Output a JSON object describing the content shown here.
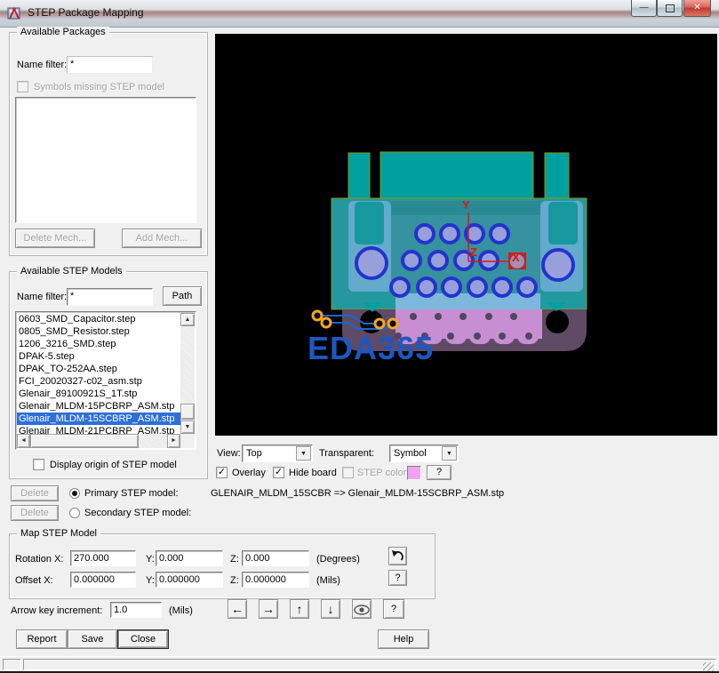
{
  "window": {
    "title": "STEP Package Mapping"
  },
  "icons": {
    "minimize": "—",
    "close": "✕",
    "check": "✓",
    "scroll_up": "▲",
    "scroll_down": "▼",
    "scroll_left": "◄",
    "scroll_right": "►",
    "dropdown": "▼",
    "nudge_left": "←",
    "nudge_right": "→",
    "nudge_up": "↑",
    "nudge_down": "↓"
  },
  "available_packages": {
    "legend": "Available Packages",
    "name_filter_label": "Name filter:",
    "name_filter_value": "*",
    "symbols_missing_label": "Symbols missing STEP model",
    "symbols_missing_checked": false,
    "delete_mech_label": "Delete Mech...",
    "add_mech_label": "Add Mech..."
  },
  "step_models": {
    "legend": "Available STEP Models",
    "name_filter_label": "Name filter:",
    "name_filter_value": "*",
    "path_label": "Path",
    "items": [
      "0603_SMD_Capacitor.step",
      "0805_SMD_Resistor.step",
      "1206_3216_SMD.step",
      "DPAK-5.step",
      "DPAK_TO-252AA.step",
      "FCI_20020327-c02_asm.stp",
      "Glenair_89100921S_1T.stp",
      "Glenair_MLDM-15PCBRP_ASM.stp",
      "Glenair_MLDM-15SCBRP_ASM.stp",
      "Glenair_MLDM-21PCBRP_ASM.stp"
    ],
    "selected_index": 8,
    "display_origin_label": "Display origin of STEP model",
    "display_origin_checked": false
  },
  "model_mapping": {
    "delete_label": "Delete",
    "primary_label": "Primary STEP model:",
    "secondary_label": "Secondary STEP model:",
    "primary_selected": true,
    "primary_value": "GLENAIR_MLDM_15SCBR => Glenair_MLDM-15SCBRP_ASM.stp",
    "secondary_value": ""
  },
  "view_controls": {
    "view_label": "View:",
    "view_value": "Top",
    "transparent_label": "Transparent:",
    "transparent_value": "Symbol",
    "overlay_label": "Overlay",
    "overlay_checked": true,
    "hide_board_label": "Hide board",
    "hide_board_checked": true,
    "step_color_label": "STEP color",
    "step_color_checked": false,
    "step_color_swatch": "#f2a2f2",
    "help_label": "?"
  },
  "viewport": {
    "watermark": "EDA365",
    "axis_x": "X",
    "axis_y": "Y",
    "axis_z": "Z",
    "axis_color": "#e21212"
  },
  "map_group": {
    "legend": "Map STEP Model",
    "rotation_label": "Rotation X:",
    "rotation_x": "270.000",
    "y_label": "Y:",
    "rotation_y": "0.000",
    "z_label": "Z:",
    "rotation_z": "0.000",
    "degrees_label": "(Degrees)",
    "offset_label": "Offset X:",
    "offset_x": "0.000000",
    "offset_y": "0.000000",
    "offset_z": "0.000000",
    "mils_label": "(Mils)",
    "help_label": "?"
  },
  "increment": {
    "label": "Arrow key increment:",
    "value": "1.0",
    "unit": "(Mils)",
    "help_label": "?"
  },
  "footer": {
    "report": "Report",
    "save": "Save",
    "close": "Close",
    "help": "Help"
  }
}
